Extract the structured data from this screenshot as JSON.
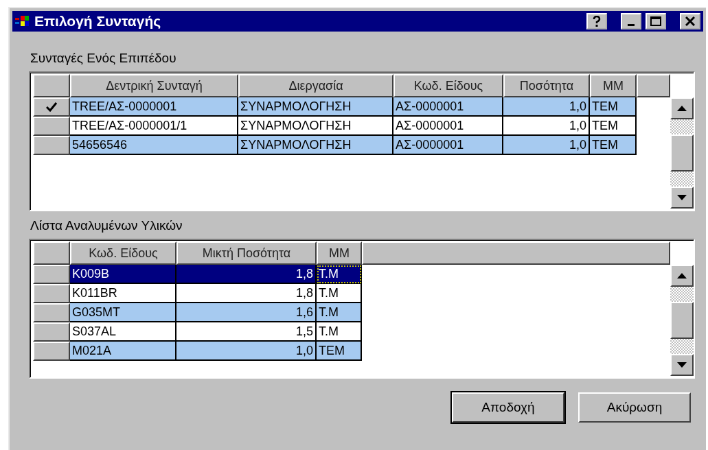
{
  "window": {
    "title": "Επιλογή Συνταγής"
  },
  "recipes": {
    "label": "Συνταγές Ενός Επιπέδου",
    "columns": [
      {
        "label": "Δεντρική Συνταγή",
        "kind": "text"
      },
      {
        "label": "Διεργασία",
        "kind": "text"
      },
      {
        "label": "Κωδ. Είδους",
        "kind": "text"
      },
      {
        "label": "Ποσότητα",
        "kind": "number"
      },
      {
        "label": "ΜΜ",
        "kind": "text"
      }
    ],
    "rows": [
      {
        "checked": true,
        "selected": true,
        "current": false,
        "cells": [
          "TREE/ΑΣ-0000001",
          "ΣΥΝΑΡΜΟΛΟΓΗΣΗ",
          "ΑΣ-0000001",
          "1,0",
          "ΤΕΜ"
        ]
      },
      {
        "checked": false,
        "selected": false,
        "current": false,
        "cells": [
          "TREE/ΑΣ-0000001/1",
          "ΣΥΝΑΡΜΟΛΟΓΗΣΗ",
          "ΑΣ-0000001",
          "1,0",
          "ΤΕΜ"
        ]
      },
      {
        "checked": false,
        "selected": true,
        "current": false,
        "cells": [
          "54656546",
          "ΣΥΝΑΡΜΟΛΟΓΗΣΗ",
          "ΑΣ-0000001",
          "1,0",
          "ΤΕΜ"
        ]
      }
    ]
  },
  "materials": {
    "label": "Λίστα Αναλυμένων Υλικών",
    "columns": [
      {
        "label": "Κωδ. Είδους",
        "kind": "text"
      },
      {
        "label": "Μικτή Ποσότητα",
        "kind": "number"
      },
      {
        "label": "ΜΜ",
        "kind": "text"
      }
    ],
    "rows": [
      {
        "checked": false,
        "selected": true,
        "current": true,
        "cells": [
          "K009B",
          "1,8",
          "T.M"
        ]
      },
      {
        "checked": false,
        "selected": false,
        "current": false,
        "cells": [
          "K011BR",
          "1,8",
          "T.M"
        ]
      },
      {
        "checked": false,
        "selected": true,
        "current": false,
        "cells": [
          "G035MT",
          "1,6",
          "T.M"
        ]
      },
      {
        "checked": false,
        "selected": false,
        "current": false,
        "cells": [
          "S037AL",
          "1,5",
          "T.M"
        ]
      },
      {
        "checked": false,
        "selected": true,
        "current": false,
        "cells": [
          "M021A",
          "1,0",
          "TEM"
        ]
      }
    ]
  },
  "buttons": [
    {
      "label": "Αποδοχή",
      "default": true
    },
    {
      "label": "Ακύρωση",
      "default": false
    }
  ]
}
